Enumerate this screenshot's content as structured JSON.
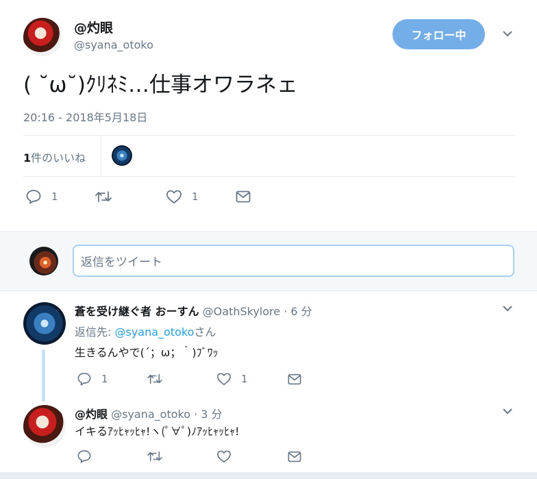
{
  "tweet": {
    "author_name": "@灼眼",
    "author_handle": "@syana_otoko",
    "follow_label": "フォロー中",
    "text": "( ˘ω˘)ｸﾘﾈﾐ…仕事オワラネェ",
    "timestamp": "20:16 - 2018年5月18日",
    "likes_count": "1",
    "likes_label": "件のいいね",
    "actions": {
      "reply_count": "1",
      "retweet_count": "",
      "like_count": "1"
    }
  },
  "reply_box": {
    "placeholder": "返信をツイート"
  },
  "replies": [
    {
      "name": "蒼を受け継ぐ者 おーすん",
      "handle": "@OathSkylore",
      "time": "· 6 分",
      "reply_to_prefix": "返信先: ",
      "reply_to_handle": "@syana_otoko",
      "reply_to_suffix": "さん",
      "text": "生きるんやで(´；ω；｀)ﾌﾞﾜｯ",
      "reply_count": "1",
      "retweet_count": "",
      "like_count": "1"
    },
    {
      "name": "@灼眼",
      "handle": "@syana_otoko",
      "time": "· 3 分",
      "text": "イキるｱｯﾋｬｯﾋｬ!ヽ(ﾟ∀ﾟ)ﾉｱｯﾋｬｯﾋｬ!",
      "reply_count": "",
      "retweet_count": "",
      "like_count": ""
    }
  ],
  "colors": {
    "accent": "#1da1f2",
    "follow_bg": "#74aee8",
    "muted": "#657786",
    "border": "#e6ecf0"
  },
  "icons": [
    "reply-icon",
    "retweet-icon",
    "like-icon",
    "dm-icon",
    "chevron-down-icon"
  ]
}
